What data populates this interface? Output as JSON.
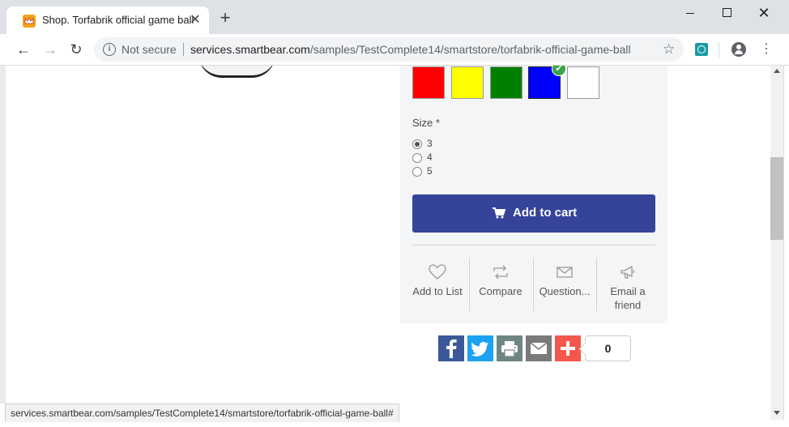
{
  "browser": {
    "tab_title": "Shop. Torfabrik official game ball",
    "tab_close": "✕",
    "new_tab": "+",
    "security_label": "Not secure",
    "url_host": "services.smartbear.com",
    "url_path": "/samples/TestComplete14/smartstore/torfabrik-official-game-ball",
    "status_url": "services.smartbear.com/samples/TestComplete14/smartstore/torfabrik-official-game-ball#"
  },
  "product": {
    "color_swatches": [
      "#ff0000",
      "#ffff00",
      "#008000",
      "#0000ff",
      "#ffffff"
    ],
    "selected_color_index": 3,
    "size_label": "Size *",
    "sizes": [
      "3",
      "4",
      "5"
    ],
    "selected_size": "3",
    "add_to_cart_label": "Add to cart",
    "accent_color": "#354398",
    "actions": [
      {
        "label": "Add to List"
      },
      {
        "label": "Compare"
      },
      {
        "label": "Question..."
      },
      {
        "label": "Email a friend"
      }
    ]
  },
  "share": {
    "count": "0",
    "colors": {
      "facebook": "#3b5998",
      "twitter": "#1da1f2",
      "print": "#6d8583",
      "email": "#7a7a7a",
      "more": "#f4574b"
    }
  }
}
